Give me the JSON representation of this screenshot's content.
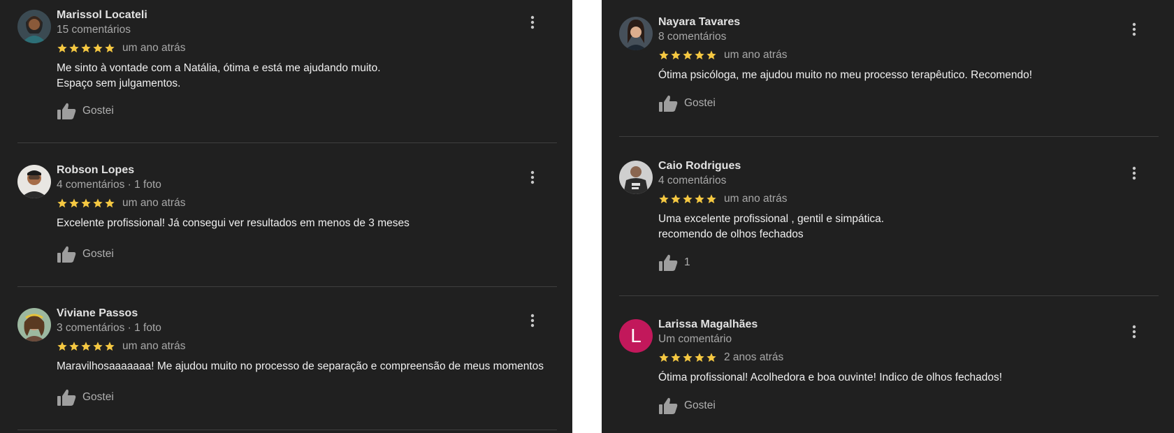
{
  "colors": {
    "background": "#202020",
    "star": "#f5c842",
    "divider": "#3f3f3f",
    "name": "#e2e2e2",
    "meta": "#a8a8a8"
  },
  "icons": {
    "star": "star-icon",
    "like": "thumbs-up-icon",
    "more": "more-vert-icon"
  },
  "left_reviews": [
    {
      "name": "Marissol Locateli",
      "meta": "15 comentários",
      "rating": 5,
      "when": "um ano atrás",
      "text_lines": [
        "Me sinto à vontade com a Natália, ótima e está me ajudando muito.",
        "Espaço sem julgamentos."
      ],
      "like_label": "Gostei"
    },
    {
      "name": "Robson Lopes",
      "meta": "4 comentários · 1 foto",
      "rating": 5,
      "when": "um ano atrás",
      "text_lines": [
        "Excelente profissional! Já consegui ver resultados em menos de 3 meses"
      ],
      "like_label": "Gostei"
    },
    {
      "name": "Viviane Passos",
      "meta": "3 comentários · 1 foto",
      "rating": 5,
      "when": "um ano atrás",
      "text_lines": [
        "Maravilhosaaaaaaa! Me ajudou muito no processo de separação e compreensão de meus momentos"
      ],
      "like_label": "Gostei"
    }
  ],
  "right_reviews": [
    {
      "name": "Nayara Tavares",
      "meta": "8 comentários",
      "rating": 5,
      "when": "um ano atrás",
      "text_lines": [
        "Ótima psicóloga, me ajudou muito no meu processo terapêutico. Recomendo!"
      ],
      "like_label": "Gostei"
    },
    {
      "name": "Caio Rodrigues",
      "meta": "4 comentários",
      "rating": 5,
      "when": "um ano atrás",
      "text_lines": [
        "Uma excelente profissional , gentil e simpática.",
        "recomendo de olhos fechados"
      ],
      "like_label": "1"
    },
    {
      "name": "Larissa Magalhães",
      "meta": "Um comentário",
      "rating": 5,
      "when": "2 anos atrás",
      "text_lines": [
        "Ótima profissional! Acolhedora e boa ouvinte! Indico de olhos fechados!"
      ],
      "like_label": "Gostei",
      "avatar_letter": "L",
      "avatar_color": "#c2185b"
    }
  ]
}
